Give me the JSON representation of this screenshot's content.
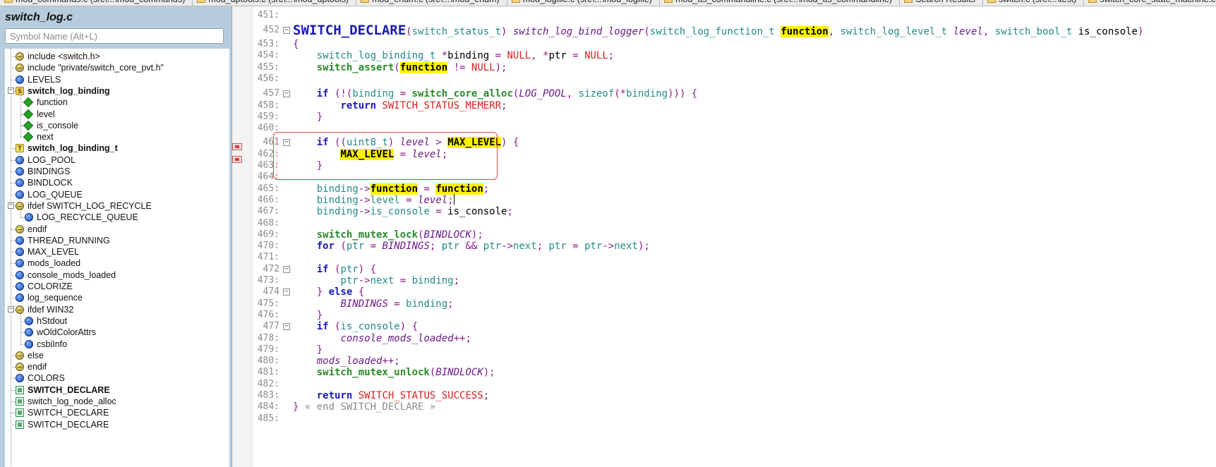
{
  "tabs": [
    {
      "label": "mod_commands.c (src\\...\\mod_commands)",
      "icon": "file-icon"
    },
    {
      "label": "mod_dptools.c (src\\...\\mod_dptools)",
      "icon": "file-icon"
    },
    {
      "label": "mod_enum.c (src\\...\\mod_enum)",
      "icon": "file-icon"
    },
    {
      "label": "mod_logfile.c (src\\...\\mod_logfile)",
      "icon": "file-icon"
    },
    {
      "label": "mod_tts_commandline.c (src\\...\\mod_tts_commandline)",
      "icon": "file-icon"
    },
    {
      "label": "Search Results",
      "icon": "search-results-icon"
    },
    {
      "label": "switch.c (src\\...\\test)",
      "icon": "file-icon"
    },
    {
      "label": "switch_core_state_machine.c (src\\...",
      "icon": "file-icon"
    }
  ],
  "sidebar": {
    "file_title": "switch_log.c",
    "search_placeholder": "Symbol Name (Alt+L)",
    "items": [
      {
        "label": "include <switch.h>",
        "kind": "preproc",
        "depth": 0
      },
      {
        "label": "include \"private/switch_core_pvt.h\"",
        "kind": "preproc",
        "depth": 0
      },
      {
        "label": "LEVELS",
        "kind": "var",
        "depth": 0
      },
      {
        "label": "switch_log_binding",
        "kind": "struct",
        "depth": 0,
        "bold": true,
        "expanded": true
      },
      {
        "label": "function",
        "kind": "member",
        "depth": 1
      },
      {
        "label": "level",
        "kind": "member",
        "depth": 1
      },
      {
        "label": "is_console",
        "kind": "member",
        "depth": 1
      },
      {
        "label": "next",
        "kind": "member",
        "depth": 1
      },
      {
        "label": "switch_log_binding_t",
        "kind": "typedef",
        "depth": 0,
        "bold": true
      },
      {
        "label": "LOG_POOL",
        "kind": "var",
        "depth": 0
      },
      {
        "label": "BINDINGS",
        "kind": "var",
        "depth": 0
      },
      {
        "label": "BINDLOCK",
        "kind": "var",
        "depth": 0
      },
      {
        "label": "LOG_QUEUE",
        "kind": "var",
        "depth": 0
      },
      {
        "label": "ifdef SWITCH_LOG_RECYCLE",
        "kind": "preproc",
        "depth": 0,
        "expanded": true
      },
      {
        "label": "LOG_RECYCLE_QUEUE",
        "kind": "var",
        "depth": 1
      },
      {
        "label": "endif",
        "kind": "preproc",
        "depth": 0
      },
      {
        "label": "THREAD_RUNNING",
        "kind": "var",
        "depth": 0
      },
      {
        "label": "MAX_LEVEL",
        "kind": "var",
        "depth": 0
      },
      {
        "label": "mods_loaded",
        "kind": "var",
        "depth": 0
      },
      {
        "label": "console_mods_loaded",
        "kind": "var",
        "depth": 0
      },
      {
        "label": "COLORIZE",
        "kind": "var",
        "depth": 0
      },
      {
        "label": "log_sequence",
        "kind": "var",
        "depth": 0
      },
      {
        "label": "ifdef WIN32",
        "kind": "preproc",
        "depth": 0,
        "expanded": true
      },
      {
        "label": "hStdout",
        "kind": "var",
        "depth": 1
      },
      {
        "label": "wOldColorAttrs",
        "kind": "var",
        "depth": 1
      },
      {
        "label": "csbiInfo",
        "kind": "var",
        "depth": 1
      },
      {
        "label": "else",
        "kind": "preproc",
        "depth": 0
      },
      {
        "label": "endif",
        "kind": "preproc",
        "depth": 0
      },
      {
        "label": "COLORS",
        "kind": "var",
        "depth": 0
      },
      {
        "label": "SWITCH_DECLARE",
        "kind": "func",
        "depth": 0,
        "bold": true
      },
      {
        "label": "switch_log_node_alloc",
        "kind": "func",
        "depth": 0
      },
      {
        "label": "SWITCH_DECLARE",
        "kind": "func",
        "depth": 0
      },
      {
        "label": "SWITCH_DECLARE",
        "kind": "func",
        "depth": 0
      }
    ]
  },
  "markers": [
    {
      "kind": "bookmark"
    },
    {
      "kind": "bookmark"
    }
  ],
  "code": {
    "lines": [
      {
        "n": "451:",
        "fold": "",
        "tokens": []
      },
      {
        "n": "452",
        "fold": "-",
        "tokens": [
          [
            "macro-big",
            "SWITCH_DECLARE"
          ],
          [
            "pn",
            "("
          ],
          [
            "ty",
            "switch_status_t"
          ],
          [
            "pn",
            ") "
          ],
          [
            "ital",
            "switch_log_bind_logger"
          ],
          [
            "pn",
            "("
          ],
          [
            "ty",
            "switch_log_function_t "
          ],
          [
            "hl",
            "function"
          ],
          [
            "pn",
            ", "
          ],
          [
            "ty",
            "switch_log_level_t "
          ],
          [
            "ital",
            "level"
          ],
          [
            "pn",
            ", "
          ],
          [
            "ty",
            "switch_bool_t "
          ],
          [
            "plain",
            "is_console"
          ],
          [
            "pn",
            ")"
          ]
        ]
      },
      {
        "n": "453:",
        "fold": "",
        "tokens": [
          [
            "pn",
            "{"
          ]
        ]
      },
      {
        "n": "454:",
        "fold": "",
        "tokens": [
          [
            "plain",
            "    "
          ],
          [
            "ty",
            "switch_log_binding_t "
          ],
          [
            "pn",
            "*"
          ],
          [
            "plain",
            "binding "
          ],
          [
            "pn",
            "= "
          ],
          [
            "str",
            "NULL"
          ],
          [
            "pn",
            ", *"
          ],
          [
            "plain",
            "ptr "
          ],
          [
            "pn",
            "= "
          ],
          [
            "str",
            "NULL"
          ],
          [
            "pn",
            ";"
          ]
        ]
      },
      {
        "n": "455:",
        "fold": "",
        "tokens": [
          [
            "plain",
            "    "
          ],
          [
            "fn",
            "switch_assert"
          ],
          [
            "pn",
            "("
          ],
          [
            "hl",
            "function"
          ],
          [
            "plain",
            " "
          ],
          [
            "pn",
            "!= "
          ],
          [
            "str",
            "NULL"
          ],
          [
            "pn",
            ");"
          ]
        ]
      },
      {
        "n": "456:",
        "fold": "",
        "tokens": []
      },
      {
        "n": "457",
        "fold": "-",
        "tokens": [
          [
            "plain",
            "    "
          ],
          [
            "kw",
            "if "
          ],
          [
            "pn",
            "(!("
          ],
          [
            "id",
            "binding "
          ],
          [
            "pn",
            "= "
          ],
          [
            "fn",
            "switch_core_alloc"
          ],
          [
            "pn",
            "("
          ],
          [
            "ital",
            "LOG_POOL"
          ],
          [
            "pn",
            ", "
          ],
          [
            "id",
            "sizeof"
          ],
          [
            "pn",
            "(*"
          ],
          [
            "id",
            "binding"
          ],
          [
            "pn",
            "))) {"
          ]
        ]
      },
      {
        "n": "458:",
        "fold": "",
        "tokens": [
          [
            "plain",
            "        "
          ],
          [
            "kw",
            "return "
          ],
          [
            "str",
            "SWITCH_STATUS_MEMERR"
          ],
          [
            "pn",
            ";"
          ]
        ]
      },
      {
        "n": "459:",
        "fold": "",
        "tokens": [
          [
            "plain",
            "    "
          ],
          [
            "pn",
            "}"
          ]
        ]
      },
      {
        "n": "460:",
        "fold": "",
        "tokens": []
      },
      {
        "n": "461",
        "fold": "-",
        "tokens": [
          [
            "plain",
            "    "
          ],
          [
            "kw",
            "if "
          ],
          [
            "pn",
            "(("
          ],
          [
            "id",
            "uint8_t"
          ],
          [
            "pn",
            ") "
          ],
          [
            "ital",
            "level "
          ],
          [
            "pn",
            "> "
          ],
          [
            "hl",
            "MAX_LEVEL"
          ],
          [
            "pn",
            ") {"
          ]
        ]
      },
      {
        "n": "462:",
        "fold": "",
        "tokens": [
          [
            "plain",
            "        "
          ],
          [
            "hl",
            "MAX_LEVEL"
          ],
          [
            "pn",
            " = "
          ],
          [
            "ital",
            "level"
          ],
          [
            "pn",
            ";"
          ]
        ]
      },
      {
        "n": "463:",
        "fold": "",
        "tokens": [
          [
            "plain",
            "    "
          ],
          [
            "pn",
            "}"
          ]
        ]
      },
      {
        "n": "464:",
        "fold": "",
        "tokens": []
      },
      {
        "n": "465:",
        "fold": "",
        "tokens": [
          [
            "plain",
            "    "
          ],
          [
            "id",
            "binding"
          ],
          [
            "pn",
            "->"
          ],
          [
            "hl",
            "function"
          ],
          [
            "pn",
            " = "
          ],
          [
            "hl",
            "function"
          ],
          [
            "pn",
            ";"
          ]
        ]
      },
      {
        "n": "466:",
        "fold": "",
        "tokens": [
          [
            "plain",
            "    "
          ],
          [
            "id",
            "binding"
          ],
          [
            "pn",
            "->"
          ],
          [
            "id",
            "level "
          ],
          [
            "pn",
            "= "
          ],
          [
            "ital",
            "level"
          ],
          [
            "pn",
            ";"
          ],
          [
            "cursor",
            ""
          ]
        ]
      },
      {
        "n": "467:",
        "fold": "",
        "tokens": [
          [
            "plain",
            "    "
          ],
          [
            "id",
            "binding"
          ],
          [
            "pn",
            "->"
          ],
          [
            "id",
            "is_console "
          ],
          [
            "pn",
            "= "
          ],
          [
            "plain",
            "is_console"
          ],
          [
            "pn",
            ";"
          ]
        ]
      },
      {
        "n": "468:",
        "fold": "",
        "tokens": []
      },
      {
        "n": "469:",
        "fold": "",
        "tokens": [
          [
            "plain",
            "    "
          ],
          [
            "fn",
            "switch_mutex_lock"
          ],
          [
            "pn",
            "("
          ],
          [
            "ital",
            "BINDLOCK"
          ],
          [
            "pn",
            ");"
          ]
        ]
      },
      {
        "n": "470:",
        "fold": "",
        "tokens": [
          [
            "plain",
            "    "
          ],
          [
            "kw",
            "for "
          ],
          [
            "pn",
            "("
          ],
          [
            "id",
            "ptr "
          ],
          [
            "pn",
            "= "
          ],
          [
            "ital",
            "BINDINGS"
          ],
          [
            "pn",
            "; "
          ],
          [
            "id",
            "ptr "
          ],
          [
            "pn",
            "&& "
          ],
          [
            "id",
            "ptr"
          ],
          [
            "pn",
            "->"
          ],
          [
            "id",
            "next"
          ],
          [
            "pn",
            "; "
          ],
          [
            "id",
            "ptr "
          ],
          [
            "pn",
            "= "
          ],
          [
            "id",
            "ptr"
          ],
          [
            "pn",
            "->"
          ],
          [
            "id",
            "next"
          ],
          [
            "pn",
            ");"
          ]
        ]
      },
      {
        "n": "471:",
        "fold": "",
        "tokens": []
      },
      {
        "n": "472",
        "fold": "-",
        "tokens": [
          [
            "plain",
            "    "
          ],
          [
            "kw",
            "if "
          ],
          [
            "pn",
            "("
          ],
          [
            "id",
            "ptr"
          ],
          [
            "pn",
            ") {"
          ]
        ]
      },
      {
        "n": "473:",
        "fold": "",
        "tokens": [
          [
            "plain",
            "        "
          ],
          [
            "id",
            "ptr"
          ],
          [
            "pn",
            "->"
          ],
          [
            "id",
            "next "
          ],
          [
            "pn",
            "= "
          ],
          [
            "id",
            "binding"
          ],
          [
            "pn",
            ";"
          ]
        ]
      },
      {
        "n": "474",
        "fold": "-",
        "tokens": [
          [
            "plain",
            "    "
          ],
          [
            "pn",
            "} "
          ],
          [
            "kw",
            "else "
          ],
          [
            "pn",
            "{"
          ]
        ]
      },
      {
        "n": "475:",
        "fold": "",
        "tokens": [
          [
            "plain",
            "        "
          ],
          [
            "ital",
            "BINDINGS "
          ],
          [
            "pn",
            "= "
          ],
          [
            "id",
            "binding"
          ],
          [
            "pn",
            ";"
          ]
        ]
      },
      {
        "n": "476:",
        "fold": "",
        "tokens": [
          [
            "plain",
            "    "
          ],
          [
            "pn",
            "}"
          ]
        ]
      },
      {
        "n": "477",
        "fold": "-",
        "tokens": [
          [
            "plain",
            "    "
          ],
          [
            "kw",
            "if "
          ],
          [
            "pn",
            "("
          ],
          [
            "id",
            "is_console"
          ],
          [
            "pn",
            ") {"
          ]
        ]
      },
      {
        "n": "478:",
        "fold": "",
        "tokens": [
          [
            "plain",
            "        "
          ],
          [
            "ital",
            "console_mods_loaded"
          ],
          [
            "pn",
            "++;"
          ]
        ]
      },
      {
        "n": "479:",
        "fold": "",
        "tokens": [
          [
            "plain",
            "    "
          ],
          [
            "pn",
            "}"
          ]
        ]
      },
      {
        "n": "480:",
        "fold": "",
        "tokens": [
          [
            "plain",
            "    "
          ],
          [
            "ital",
            "mods_loaded"
          ],
          [
            "pn",
            "++;"
          ]
        ]
      },
      {
        "n": "481:",
        "fold": "",
        "tokens": [
          [
            "plain",
            "    "
          ],
          [
            "fn",
            "switch_mutex_unlock"
          ],
          [
            "pn",
            "("
          ],
          [
            "ital",
            "BINDLOCK"
          ],
          [
            "pn",
            ");"
          ]
        ]
      },
      {
        "n": "482:",
        "fold": "",
        "tokens": []
      },
      {
        "n": "483:",
        "fold": "",
        "tokens": [
          [
            "plain",
            "    "
          ],
          [
            "kw",
            "return "
          ],
          [
            "str",
            "SWITCH_STATUS_SUCCESS"
          ],
          [
            "pn",
            ";"
          ]
        ]
      },
      {
        "n": "484:",
        "fold": "",
        "tokens": [
          [
            "pn",
            "} "
          ],
          [
            "cmt",
            "« end SWITCH_DECLARE »"
          ]
        ]
      },
      {
        "n": "485:",
        "fold": "",
        "tokens": []
      }
    ]
  }
}
